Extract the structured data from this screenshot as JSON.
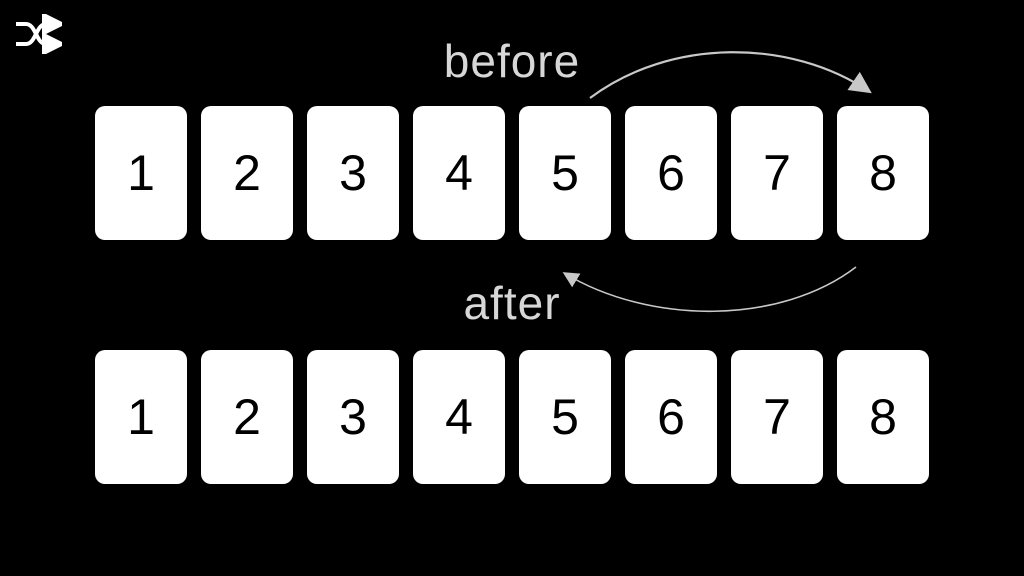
{
  "labels": {
    "before": "before",
    "after": "after"
  },
  "rows": {
    "before": [
      "1",
      "2",
      "3",
      "4",
      "5",
      "6",
      "7",
      "8"
    ],
    "after": [
      "1",
      "2",
      "3",
      "4",
      "5",
      "6",
      "7",
      "8"
    ]
  },
  "icons": {
    "shuffle": "shuffle-icon"
  }
}
